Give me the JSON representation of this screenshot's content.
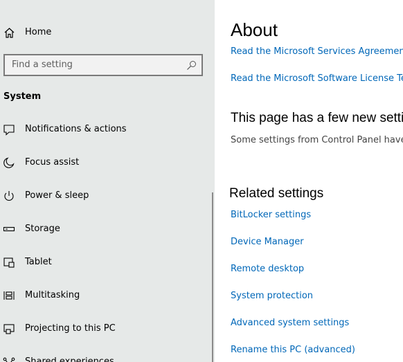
{
  "sidebar": {
    "home_label": "Home",
    "search_placeholder": "Find a setting",
    "section_heading": "System",
    "items": [
      {
        "label": "Notifications & actions",
        "icon": "notification-icon"
      },
      {
        "label": "Focus assist",
        "icon": "moon-icon"
      },
      {
        "label": "Power & sleep",
        "icon": "power-icon"
      },
      {
        "label": "Storage",
        "icon": "storage-icon"
      },
      {
        "label": "Tablet",
        "icon": "tablet-icon"
      },
      {
        "label": "Multitasking",
        "icon": "multitasking-icon"
      },
      {
        "label": "Projecting to this PC",
        "icon": "projector-icon"
      },
      {
        "label": "Shared experiences",
        "icon": "share-icon"
      }
    ]
  },
  "main": {
    "title": "About",
    "links": [
      "Read the Microsoft Services Agreement that applies to our services",
      "Read the Microsoft Software License Terms"
    ],
    "new_settings_heading": "This page has a few new settings",
    "new_settings_body": "Some settings from Control Panel have moved to this page.",
    "related_heading": "Related settings",
    "related_links": [
      "BitLocker settings",
      "Device Manager",
      "Remote desktop",
      "System protection",
      "Advanced system settings",
      "Rename this PC (advanced)"
    ]
  },
  "colors": {
    "sidebar_bg": "#e6e9e8",
    "link": "#0067b8",
    "text": "#000000"
  }
}
